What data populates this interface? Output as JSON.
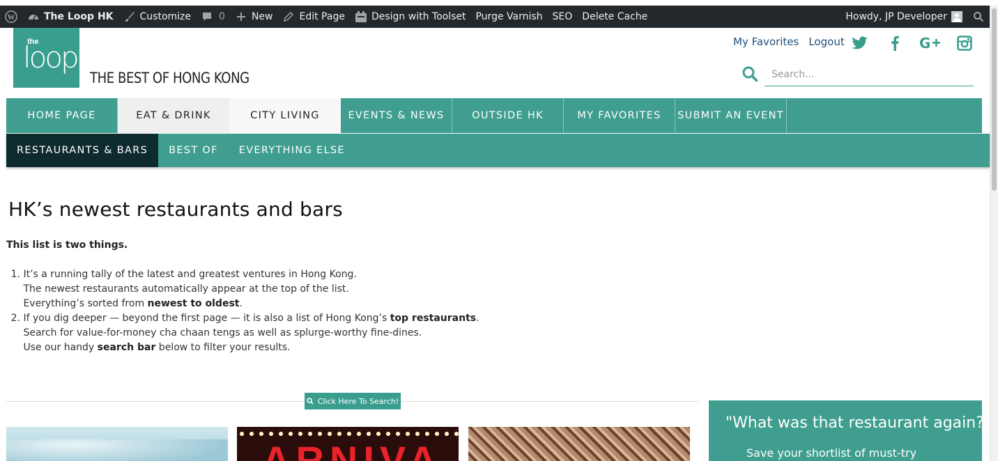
{
  "adminbar": {
    "site": "The Loop HK",
    "customize": "Customize",
    "comments_count": "0",
    "new": "New",
    "edit_page": "Edit Page",
    "toolset": "Design with Toolset",
    "purge": "Purge Varnish",
    "seo": "SEO",
    "delete_cache": "Delete Cache",
    "howdy": "Howdy, JP Developer"
  },
  "header": {
    "logo_small": "the",
    "logo_big": "loop",
    "tagline": "THE BEST OF HONG KONG",
    "links": {
      "favorites": "My Favorites",
      "logout": "Logout"
    },
    "social_icons": [
      "twitter-icon",
      "facebook-icon",
      "google-plus-icon",
      "instagram-icon"
    ],
    "search": {
      "placeholder": "Search..."
    }
  },
  "mainnav": [
    {
      "label": "HOME PAGE"
    },
    {
      "label": "EAT & DRINK"
    },
    {
      "label": "CITY LIVING"
    },
    {
      "label": "EVENTS & NEWS"
    },
    {
      "label": "OUTSIDE HK"
    },
    {
      "label": "MY FAVORITES"
    },
    {
      "label": "SUBMIT AN EVENT"
    }
  ],
  "subnav": [
    {
      "label": "RESTAURANTS & BARS"
    },
    {
      "label": "BEST OF"
    },
    {
      "label": "EVERYTHING ELSE"
    }
  ],
  "content": {
    "title": "HK’s newest restaurants and bars",
    "intro": "This list is two things.",
    "item1": {
      "num": "1.",
      "line1": "It’s a running tally of the latest and greatest ventures in Hong Kong.",
      "line2": "The newest restaurants automatically appear at the top of the list.",
      "line3_pre": "Everything’s sorted from ",
      "line3_bold": "newest to oldest",
      "line3_post": "."
    },
    "item2": {
      "num": "2.",
      "line1_pre": "If you dig deeper — beyond the first page — it is also a list of Hong Kong’s ",
      "line1_bold": "top restaurants",
      "line1_post": ".",
      "line2": "Search for value-for-money cha chaan tengs as well as splurge-worthy fine-dines.",
      "line3_pre": "Use our handy ",
      "line3_bold": "search bar",
      "line3_post": " below to filter your results."
    },
    "search_button": "Click Here To Search!",
    "thumb2_text": "ARNIVA"
  },
  "promo": {
    "title": "\"What was that restaurant again?\"",
    "body": "Save your shortlist of must-try"
  },
  "colors": {
    "teal": "#3f9e8f",
    "adminbar": "#23282d",
    "active_sub": "#0d2a2e"
  }
}
